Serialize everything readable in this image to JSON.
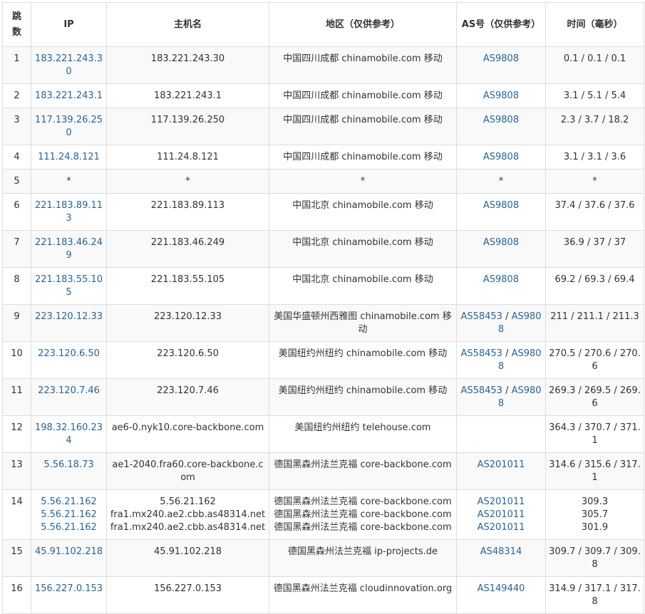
{
  "headers": {
    "hop": "跳数",
    "ip": "IP",
    "host": "主机名",
    "region": "地区（仅供参考）",
    "as": "AS号（仅供参考）",
    "time": "时间（毫秒）"
  },
  "rows": [
    {
      "hop": "1",
      "ip": "183.221.243.30",
      "host": "183.221.243.30",
      "region": "中国四川成都 chinamobile.com 移动",
      "as": "AS9808",
      "time": "0.1 / 0.1 / 0.1"
    },
    {
      "hop": "2",
      "ip": "183.221.243.1",
      "host": "183.221.243.1",
      "region": "中国四川成都 chinamobile.com 移动",
      "as": "AS9808",
      "time": "3.1 / 5.1 / 5.4"
    },
    {
      "hop": "3",
      "ip": "117.139.26.250",
      "host": "117.139.26.250",
      "region": "中国四川成都 chinamobile.com 移动",
      "as": "AS9808",
      "time": "2.3 / 3.7 / 18.2"
    },
    {
      "hop": "4",
      "ip": "111.24.8.121",
      "host": "111.24.8.121",
      "region": "中国四川成都 chinamobile.com 移动",
      "as": "AS9808",
      "time": "3.1 / 3.1 / 3.6"
    },
    {
      "hop": "5",
      "ip": "*",
      "host": "*",
      "region": "*",
      "as": "*",
      "time": "*"
    },
    {
      "hop": "6",
      "ip": "221.183.89.113",
      "host": "221.183.89.113",
      "region": "中国北京 chinamobile.com 移动",
      "as": "AS9808",
      "time": "37.4 / 37.6 / 37.6"
    },
    {
      "hop": "7",
      "ip": "221.183.46.249",
      "host": "221.183.46.249",
      "region": "中国北京 chinamobile.com 移动",
      "as": "AS9808",
      "time": "36.9 / 37 / 37"
    },
    {
      "hop": "8",
      "ip": "221.183.55.105",
      "host": "221.183.55.105",
      "region": "中国北京 chinamobile.com 移动",
      "as": "AS9808",
      "time": "69.2 / 69.3 / 69.4"
    },
    {
      "hop": "9",
      "ip": "223.120.12.33",
      "host": "223.120.12.33",
      "region": "美国华盛顿州西雅图 chinamobile.com 移动",
      "as_a": "AS58453",
      "as_b": "AS9808",
      "time": "211 / 211.1 / 211.3"
    },
    {
      "hop": "10",
      "ip": "223.120.6.50",
      "host": "223.120.6.50",
      "region": "美国纽约州纽约 chinamobile.com 移动",
      "as_a": "AS58453",
      "as_b": "AS9808",
      "time": "270.5 / 270.6 / 270.6"
    },
    {
      "hop": "11",
      "ip": "223.120.7.46",
      "host": "223.120.7.46",
      "region": "美国纽约州纽约 chinamobile.com 移动",
      "as_a": "AS58453",
      "as_b": "AS9808",
      "time": "269.3 / 269.5 / 269.6"
    },
    {
      "hop": "12",
      "ip": "198.32.160.234",
      "host": "ae6-0.nyk10.core-backbone.com",
      "region": "美国纽约州纽约 telehouse.com",
      "as": "",
      "time": "364.3 / 370.7 / 371.1"
    },
    {
      "hop": "13",
      "ip": "5.56.18.73",
      "host": "ae1-2040.fra60.core-backbone.com",
      "region": "德国黑森州法兰克福 core-backbone.com",
      "as": "AS201011",
      "time": "314.6 / 315.6 / 317.1"
    },
    {
      "hop": "14",
      "ip": [
        "5.56.21.162",
        "5.56.21.162",
        "5.56.21.162"
      ],
      "host": [
        "5.56.21.162",
        "fra1.mx240.ae2.cbb.as48314.net",
        "fra1.mx240.ae2.cbb.as48314.net"
      ],
      "region": [
        "德国黑森州法兰克福 core-backbone.com",
        "德国黑森州法兰克福 core-backbone.com",
        "德国黑森州法兰克福 core-backbone.com"
      ],
      "as": [
        "AS201011",
        "AS201011",
        "AS201011"
      ],
      "time": [
        "309.3",
        "305.7",
        "301.9"
      ]
    },
    {
      "hop": "15",
      "ip": "45.91.102.218",
      "host": "45.91.102.218",
      "region": "德国黑森州法兰克福 ip-projects.de",
      "as": "AS48314",
      "time": "309.7 / 309.7 / 309.8"
    },
    {
      "hop": "16",
      "ip": "156.227.0.153",
      "host": "156.227.0.153",
      "region": "德国黑森州法兰克福 cloudinnovation.org",
      "as": "AS149440",
      "time": "314.9 / 317.1 / 317.8"
    }
  ]
}
